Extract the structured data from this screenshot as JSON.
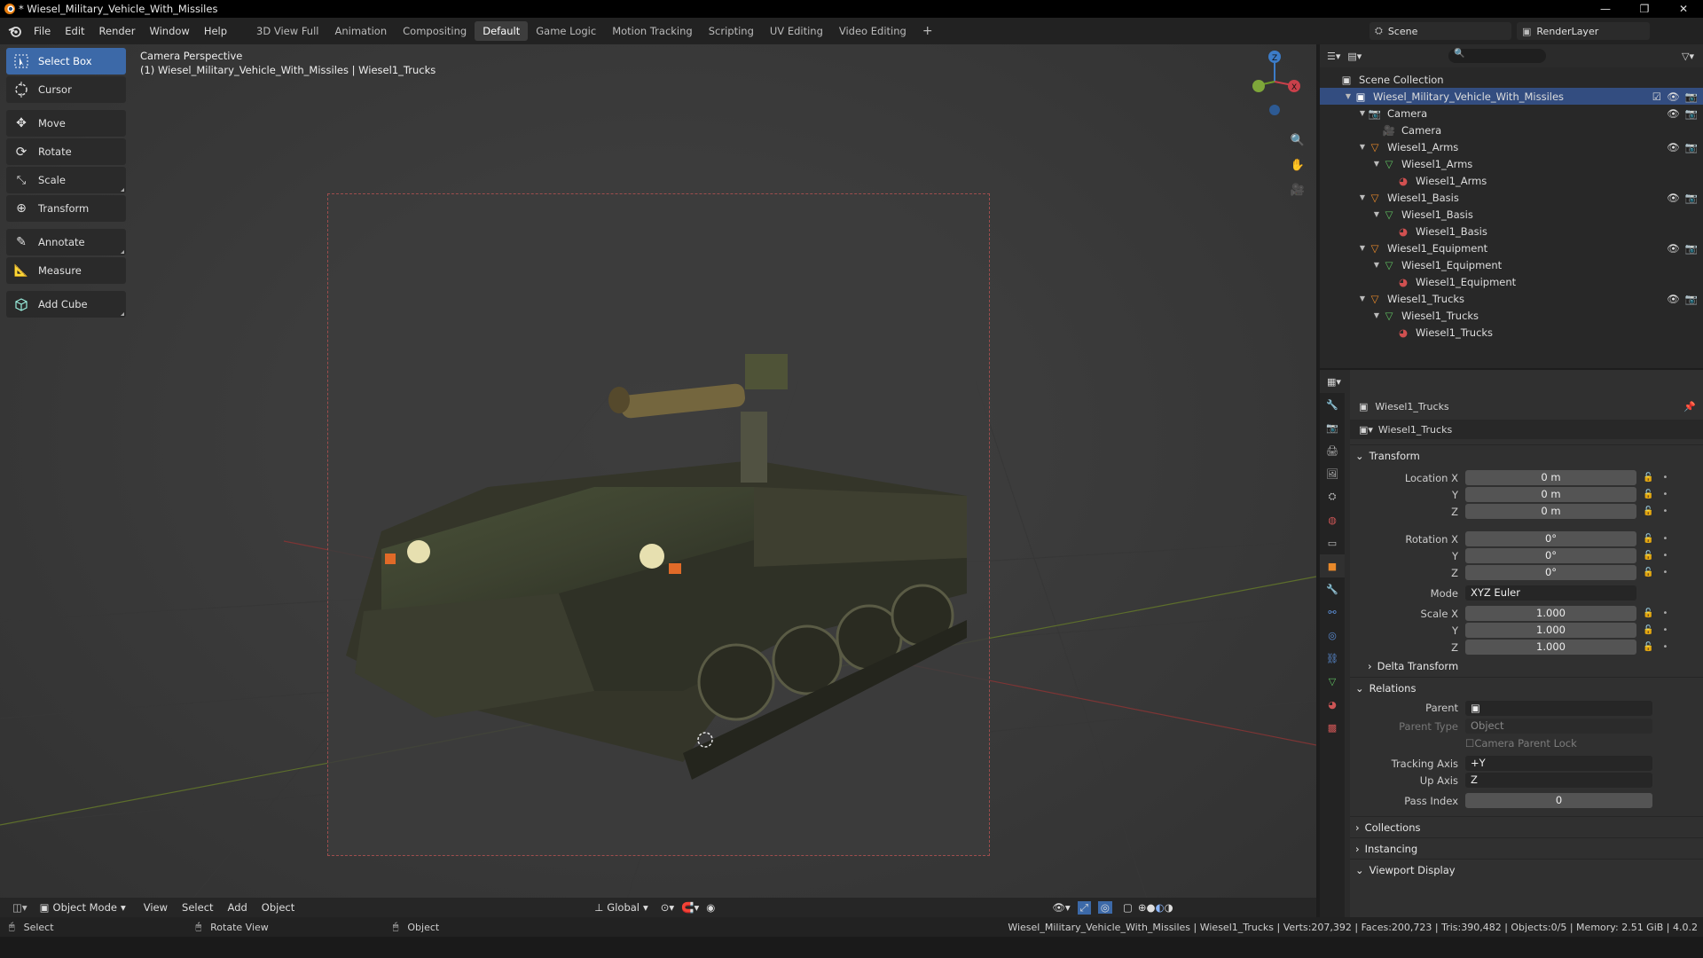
{
  "window": {
    "title": "* Wiesel_Military_Vehicle_With_Missiles",
    "controls": [
      "—",
      "❐",
      "✕"
    ]
  },
  "menu": {
    "items": [
      "File",
      "Edit",
      "Render",
      "Window",
      "Help"
    ]
  },
  "workspaces": {
    "tabs": [
      "3D View Full",
      "Animation",
      "Compositing",
      "Default",
      "Game Logic",
      "Motion Tracking",
      "Scripting",
      "UV Editing",
      "Video Editing"
    ],
    "active": "Default",
    "add": "+"
  },
  "scene": {
    "name": "Scene",
    "render_layer": "RenderLayer"
  },
  "tools": [
    "Select Box",
    "Cursor",
    "Move",
    "Rotate",
    "Scale",
    "Transform",
    "Annotate",
    "Measure",
    "Add Cube"
  ],
  "viewport": {
    "line1": "Camera Perspective",
    "line2": "(1) Wiesel_Military_Vehicle_With_Missiles | Wiesel1_Trucks"
  },
  "gizmo": {
    "z": "Z",
    "x": "X"
  },
  "outliner": {
    "root": "Scene Collection",
    "collection": "Wiesel_Military_Vehicle_With_Missiles",
    "rows": [
      {
        "label": "Camera",
        "level": 1,
        "icon": "camera-object-icon"
      },
      {
        "label": "Camera",
        "level": 2,
        "icon": "camera-data-icon"
      },
      {
        "label": "Wiesel1_Arms",
        "level": 1,
        "icon": "mesh-object-icon"
      },
      {
        "label": "Wiesel1_Arms",
        "level": 2,
        "icon": "mesh-data-icon"
      },
      {
        "label": "Wiesel1_Arms",
        "level": 3,
        "icon": "material-icon"
      },
      {
        "label": "Wiesel1_Basis",
        "level": 1,
        "icon": "mesh-object-icon"
      },
      {
        "label": "Wiesel1_Basis",
        "level": 2,
        "icon": "mesh-data-icon"
      },
      {
        "label": "Wiesel1_Basis",
        "level": 3,
        "icon": "material-icon"
      },
      {
        "label": "Wiesel1_Equipment",
        "level": 1,
        "icon": "mesh-object-icon"
      },
      {
        "label": "Wiesel1_Equipment",
        "level": 2,
        "icon": "mesh-data-icon"
      },
      {
        "label": "Wiesel1_Equipment",
        "level": 3,
        "icon": "material-icon"
      },
      {
        "label": "Wiesel1_Trucks",
        "level": 1,
        "icon": "mesh-object-icon"
      },
      {
        "label": "Wiesel1_Trucks",
        "level": 2,
        "icon": "mesh-data-icon"
      },
      {
        "label": "Wiesel1_Trucks",
        "level": 3,
        "icon": "material-icon"
      }
    ]
  },
  "properties": {
    "object_name": "Wiesel1_Trucks",
    "data_name": "Wiesel1_Trucks",
    "transform": {
      "title": "Transform",
      "rows": [
        {
          "label": "Location X",
          "value": "0 m"
        },
        {
          "label": "Y",
          "value": "0 m"
        },
        {
          "label": "Z",
          "value": "0 m"
        },
        {
          "label": "Rotation X",
          "value": "0°"
        },
        {
          "label": "Y",
          "value": "0°"
        },
        {
          "label": "Z",
          "value": "0°"
        }
      ],
      "mode_label": "Mode",
      "mode_value": "XYZ Euler",
      "scale": [
        {
          "label": "Scale X",
          "value": "1.000"
        },
        {
          "label": "Y",
          "value": "1.000"
        },
        {
          "label": "Z",
          "value": "1.000"
        }
      ]
    },
    "delta": "Delta Transform",
    "relations": {
      "title": "Relations",
      "parent": "Parent",
      "parent_type": "Parent Type",
      "parent_type_value": "Object",
      "camera_parent_lock": "Camera Parent Lock",
      "tracking_axis": "Tracking Axis",
      "tracking_value": "+Y",
      "up_axis": "Up Axis",
      "up_value": "Z",
      "pass_index": "Pass Index",
      "pass_value": "0"
    },
    "collapsed": [
      "Collections",
      "Instancing"
    ],
    "viewport_display": "Viewport Display"
  },
  "header3d": {
    "mode": "Object Mode",
    "menus": [
      "View",
      "Select",
      "Add",
      "Object"
    ],
    "orientation": "Global"
  },
  "status": {
    "select": "Select",
    "rotate": "Rotate View",
    "object": "Object",
    "stats": "Wiesel_Military_Vehicle_With_Missiles | Wiesel1_Trucks | Verts:207,392 | Faces:200,723 | Tris:390,482 | Objects:0/5 | Memory: 2.51 GiB | 4.0.2"
  },
  "colors": {
    "accent": "#3c69a8",
    "selection": "#334d80",
    "axis_x": "#c9404a",
    "axis_y": "#6e9a2a",
    "axis_z": "#3c7cc8"
  }
}
